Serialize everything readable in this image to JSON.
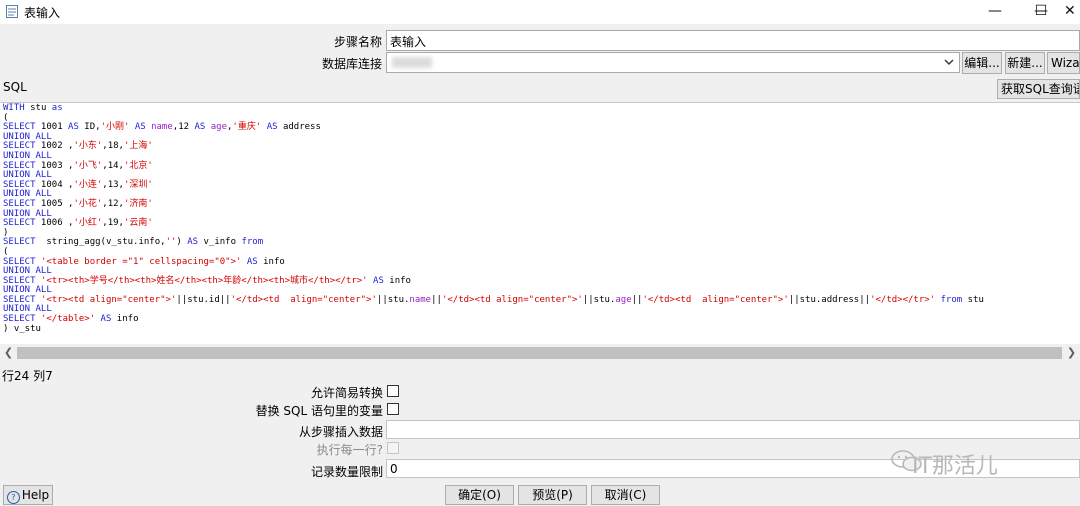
{
  "window": {
    "title": "表输入",
    "minimize": "—",
    "maximize": "☐",
    "close": "✕"
  },
  "form": {
    "step_name_label": "步骤名称",
    "step_name_value": "表输入",
    "db_conn_label": "数据库连接",
    "db_conn_value": "",
    "edit_button": "编辑...",
    "new_button": "新建...",
    "wizard_button": "Wizar",
    "sql_label": "SQL",
    "get_sql_button": "获取SQL查询语句"
  },
  "status": {
    "row_col": "行24 列7"
  },
  "options": {
    "allow_lazy_label": "允许简易转换",
    "replace_vars_label": "替换 SQL 语句里的变量",
    "insert_from_step_label": "从步骤插入数据",
    "insert_from_step_value": "",
    "execute_each_row_label": "执行每一行?",
    "limit_label": "记录数量限制",
    "limit_value": "0"
  },
  "buttons": {
    "help": "Help",
    "ok": "确定(O)",
    "preview": "预览(P)",
    "cancel": "取消(C)"
  },
  "watermark": {
    "text": "IT那活儿"
  },
  "sql_lines": [
    [
      [
        "kw",
        "WITH"
      ],
      [
        "t",
        " stu "
      ],
      [
        "kw",
        "as"
      ]
    ],
    [
      [
        "t",
        "("
      ]
    ],
    [
      [
        "kw",
        "SELECT"
      ],
      [
        "t",
        " 1001 "
      ],
      [
        "kw",
        "AS"
      ],
      [
        "t",
        " ID,"
      ],
      [
        "str",
        "'小刚'"
      ],
      [
        "t",
        " "
      ],
      [
        "kw",
        "AS"
      ],
      [
        "t",
        " "
      ],
      [
        "fn",
        "name"
      ],
      [
        "t",
        ",12 "
      ],
      [
        "kw",
        "AS"
      ],
      [
        "t",
        " "
      ],
      [
        "fn",
        "age"
      ],
      [
        "t",
        ","
      ],
      [
        "str",
        "'重庆'"
      ],
      [
        "t",
        " "
      ],
      [
        "kw",
        "AS"
      ],
      [
        "t",
        " address"
      ]
    ],
    [
      [
        "kw",
        "UNION ALL"
      ]
    ],
    [
      [
        "kw",
        "SELECT"
      ],
      [
        "t",
        " 1002 ,"
      ],
      [
        "str",
        "'小东'"
      ],
      [
        "t",
        ",18,"
      ],
      [
        "str",
        "'上海'"
      ]
    ],
    [
      [
        "kw",
        "UNION ALL"
      ]
    ],
    [
      [
        "kw",
        "SELECT"
      ],
      [
        "t",
        " 1003 ,"
      ],
      [
        "str",
        "'小飞'"
      ],
      [
        "t",
        ",14,"
      ],
      [
        "str",
        "'北京'"
      ]
    ],
    [
      [
        "kw",
        "UNION ALL"
      ]
    ],
    [
      [
        "kw",
        "SELECT"
      ],
      [
        "t",
        " 1004 ,"
      ],
      [
        "str",
        "'小连'"
      ],
      [
        "t",
        ",13,"
      ],
      [
        "str",
        "'深圳'"
      ]
    ],
    [
      [
        "kw",
        "UNION ALL"
      ]
    ],
    [
      [
        "kw",
        "SELECT"
      ],
      [
        "t",
        " 1005 ,"
      ],
      [
        "str",
        "'小花'"
      ],
      [
        "t",
        ",12,"
      ],
      [
        "str",
        "'济南'"
      ]
    ],
    [
      [
        "kw",
        "UNION ALL"
      ]
    ],
    [
      [
        "kw",
        "SELECT"
      ],
      [
        "t",
        " 1006 ,"
      ],
      [
        "str",
        "'小红'"
      ],
      [
        "t",
        ",19,"
      ],
      [
        "str",
        "'云南'"
      ]
    ],
    [
      [
        "t",
        ")"
      ]
    ],
    [
      [
        "kw",
        "SELECT"
      ],
      [
        "t",
        "  string_agg(v_stu.info,"
      ],
      [
        "str",
        "''"
      ],
      [
        "t",
        ") "
      ],
      [
        "kw",
        "AS"
      ],
      [
        "t",
        " v_info "
      ],
      [
        "kw",
        "from"
      ]
    ],
    [
      [
        "t",
        "("
      ]
    ],
    [
      [
        "kw",
        "SELECT"
      ],
      [
        "t",
        " "
      ],
      [
        "str",
        "'<table border =\"1\" cellspacing=\"0\">'"
      ],
      [
        "t",
        " "
      ],
      [
        "kw",
        "AS"
      ],
      [
        "t",
        " info"
      ]
    ],
    [
      [
        "kw",
        "UNION ALL"
      ]
    ],
    [
      [
        "kw",
        "SELECT"
      ],
      [
        "t",
        " "
      ],
      [
        "str",
        "'<tr><th>学号</th><th>姓名</th><th>年龄</th><th>城市</th></tr>'"
      ],
      [
        "t",
        " "
      ],
      [
        "kw",
        "AS"
      ],
      [
        "t",
        " info"
      ]
    ],
    [
      [
        "kw",
        "UNION ALL"
      ]
    ],
    [
      [
        "kw",
        "SELECT"
      ],
      [
        "t",
        " "
      ],
      [
        "str",
        "'<tr><td align=\"center\">'"
      ],
      [
        "t",
        "||stu.id||"
      ],
      [
        "str",
        "'</td><td  align=\"center\">'"
      ],
      [
        "t",
        "||stu."
      ],
      [
        "fn",
        "name"
      ],
      [
        "t",
        "||"
      ],
      [
        "str",
        "'</td><td align=\"center\">'"
      ],
      [
        "t",
        "||stu."
      ],
      [
        "fn",
        "age"
      ],
      [
        "t",
        "||"
      ],
      [
        "str",
        "'</td><td  align=\"center\">'"
      ],
      [
        "t",
        "||stu.address||"
      ],
      [
        "str",
        "'</td></tr>'"
      ],
      [
        "t",
        " "
      ],
      [
        "kw",
        "from"
      ],
      [
        "t",
        " stu"
      ]
    ],
    [
      [
        "kw",
        "UNION ALL"
      ]
    ],
    [
      [
        "kw",
        "SELECT"
      ],
      [
        "t",
        " "
      ],
      [
        "str",
        "'</table>'"
      ],
      [
        "t",
        " "
      ],
      [
        "kw",
        "AS"
      ],
      [
        "t",
        " info"
      ]
    ],
    [
      [
        "t",
        ") v_stu"
      ]
    ]
  ]
}
